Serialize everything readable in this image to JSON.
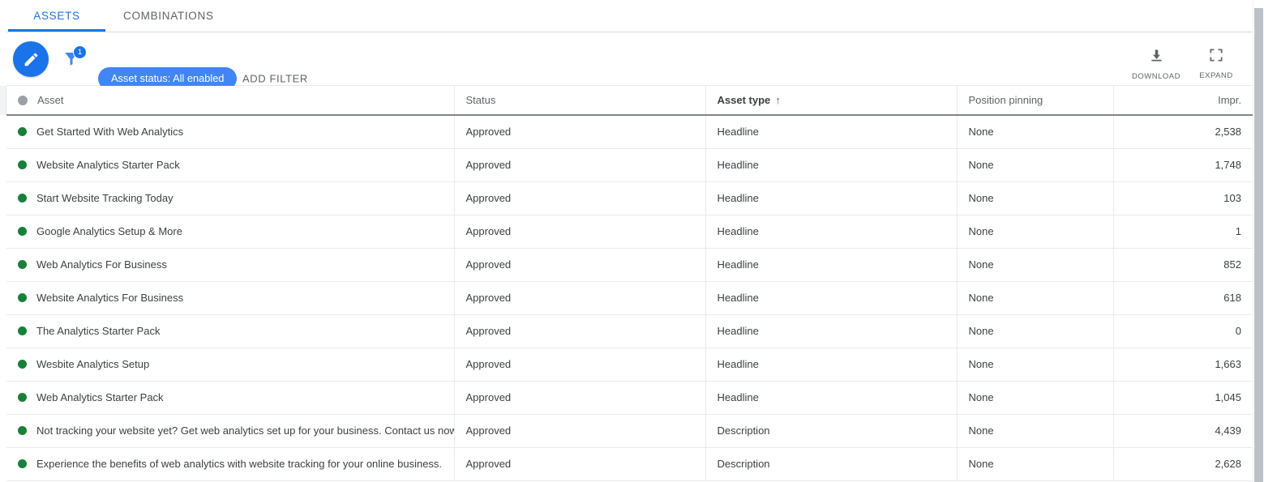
{
  "tabs": [
    {
      "label": "ASSETS",
      "active": true
    },
    {
      "label": "COMBINATIONS",
      "active": false
    }
  ],
  "toolbar": {
    "edit_icon": "pencil-icon",
    "filter_icon": "filter-funnel-icon",
    "filter_badge_count": "1",
    "filter_chip_label": "Asset status: All enabled",
    "add_filter_label": "ADD FILTER",
    "download_label": "DOWNLOAD",
    "download_icon": "download-icon",
    "expand_label": "EXPAND",
    "expand_icon": "expand-icon",
    "accent_color": "#1a73e8",
    "chip_color": "#4285f4"
  },
  "table": {
    "columns": [
      {
        "key": "asset",
        "label": "Asset",
        "align": "left",
        "sorted": false,
        "has_status_dot": true
      },
      {
        "key": "status",
        "label": "Status",
        "align": "left",
        "sorted": false
      },
      {
        "key": "type",
        "label": "Asset type",
        "align": "left",
        "sorted": true,
        "sort_direction": "ascending",
        "sort_glyph": "↑"
      },
      {
        "key": "pinning",
        "label": "Position pinning",
        "align": "left",
        "sorted": false
      },
      {
        "key": "impr",
        "label": "Impr.",
        "align": "right",
        "sorted": false
      }
    ],
    "status_dot_color": "#188038",
    "rows": [
      {
        "asset": "Get Started With Web Analytics",
        "status": "Approved",
        "type": "Headline",
        "pinning": "None",
        "impr": "2,538"
      },
      {
        "asset": "Website Analytics Starter Pack",
        "status": "Approved",
        "type": "Headline",
        "pinning": "None",
        "impr": "1,748"
      },
      {
        "asset": "Start Website Tracking Today",
        "status": "Approved",
        "type": "Headline",
        "pinning": "None",
        "impr": "103"
      },
      {
        "asset": "Google Analytics Setup & More",
        "status": "Approved",
        "type": "Headline",
        "pinning": "None",
        "impr": "1"
      },
      {
        "asset": "Web Analytics For Business",
        "status": "Approved",
        "type": "Headline",
        "pinning": "None",
        "impr": "852"
      },
      {
        "asset": "Website Analytics For Business",
        "status": "Approved",
        "type": "Headline",
        "pinning": "None",
        "impr": "618"
      },
      {
        "asset": "The Analytics Starter Pack",
        "status": "Approved",
        "type": "Headline",
        "pinning": "None",
        "impr": "0"
      },
      {
        "asset": "Wesbite Analytics Setup",
        "status": "Approved",
        "type": "Headline",
        "pinning": "None",
        "impr": "1,663"
      },
      {
        "asset": "Web Analytics Starter Pack",
        "status": "Approved",
        "type": "Headline",
        "pinning": "None",
        "impr": "1,045"
      },
      {
        "asset": "Not tracking your website yet? Get web analytics set up for your business. Contact us now.",
        "status": "Approved",
        "type": "Description",
        "pinning": "None",
        "impr": "4,439"
      },
      {
        "asset": "Experience the benefits of web analytics with website tracking for your online business.",
        "status": "Approved",
        "type": "Description",
        "pinning": "None",
        "impr": "2,628"
      }
    ]
  }
}
